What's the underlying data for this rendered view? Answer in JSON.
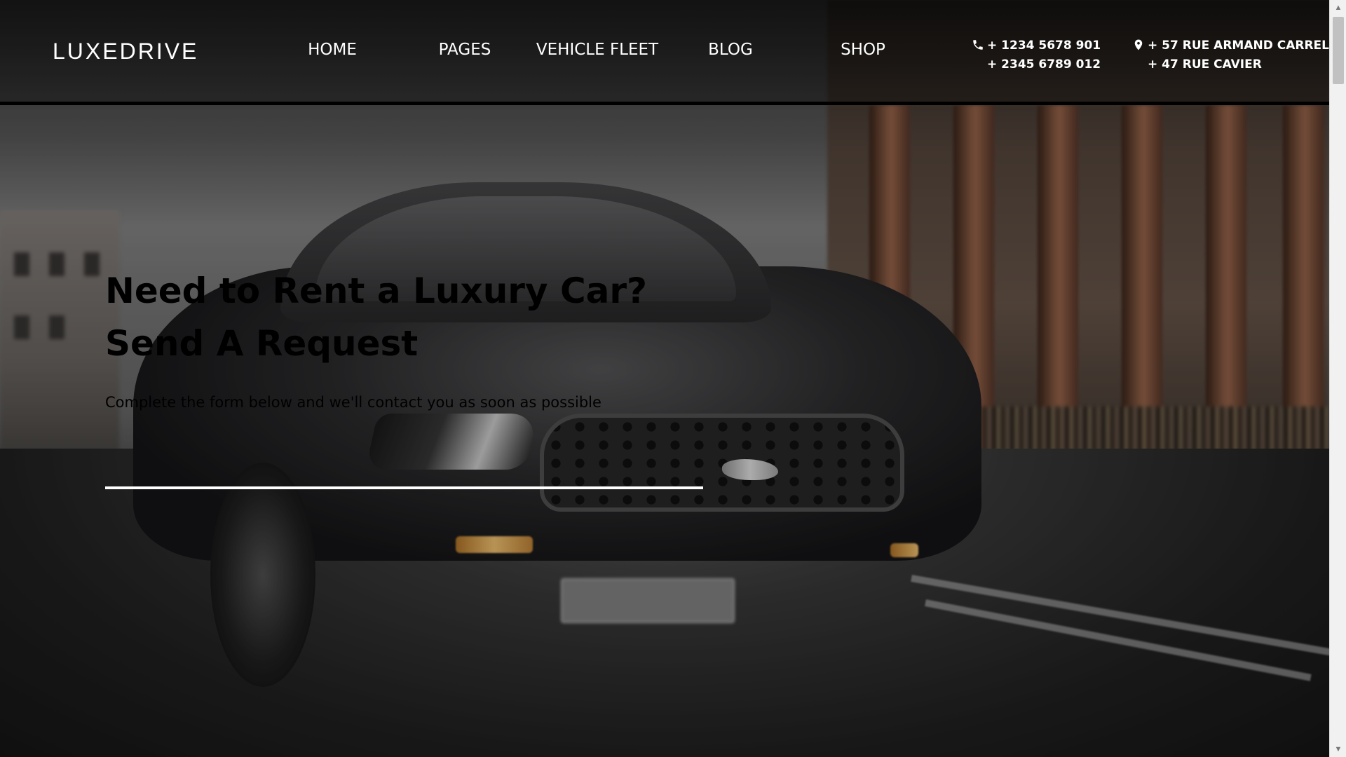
{
  "brand": {
    "logo_text": "LUXEDRIVE"
  },
  "nav": {
    "items": [
      {
        "label": "HOME"
      },
      {
        "label": "PAGES"
      },
      {
        "label": "VEHICLE FLEET"
      },
      {
        "label": "BLOG"
      },
      {
        "label": "SHOP"
      }
    ]
  },
  "contact": {
    "phone_icon": "phone-icon",
    "phones": [
      "+ 1234 5678 901",
      "+ 2345 6789 012"
    ],
    "location_icon": "map-pin-icon",
    "addresses": [
      "+ 57 RUE ARMAND CARREL",
      "+ 47 RUE CAVIER"
    ]
  },
  "hero": {
    "title_line1": "Need to Rent a Luxury Car?",
    "title_line2": "Send A Request",
    "subtitle": "Complete the form below and we'll contact you as soon as possible"
  },
  "scrollbar": {
    "up_icon": "scroll-up-arrow-icon",
    "down_icon": "scroll-down-arrow-icon"
  },
  "colors": {
    "header_border": "#000000",
    "text_white": "#ffffff",
    "hero_text": "#000000"
  }
}
